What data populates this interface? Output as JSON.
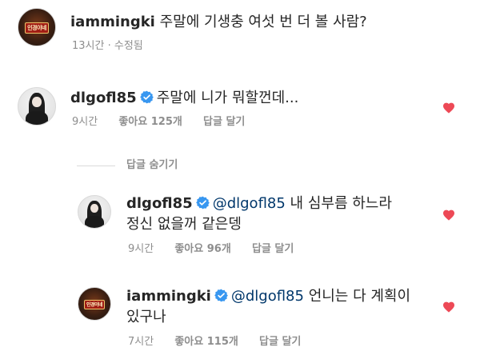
{
  "comments": [
    {
      "username": "iammingki",
      "verified": false,
      "text": "주말에 기생충 여섯 번 더 볼 사람?",
      "time": "13시간",
      "edited": "· 수정됨",
      "avatar_sign": "인경이네"
    },
    {
      "username": "dlgofl85",
      "verified": true,
      "text": "주말에 니가 뭐할껀데...",
      "time": "9시간",
      "likes": "좋아요 125개",
      "reply_label": "답글 달기"
    }
  ],
  "hide_replies_label": "답글 숨기기",
  "replies": [
    {
      "username": "dlgofl85",
      "verified": true,
      "mention": "@dlgofl85",
      "text_line1": "내 심부름 하느라",
      "text_line2": "정신 없을꺼 같은뎅",
      "time": "9시간",
      "likes": "좋아요 96개",
      "reply_label": "답글 달기"
    },
    {
      "username": "iammingki",
      "verified": true,
      "mention": "@dlgofl85",
      "text_line1": "언니는 다 계획이",
      "text_line2": "있구나",
      "time": "7시간",
      "likes": "좋아요 115개",
      "reply_label": "답글 달기",
      "avatar_sign": "인경이네"
    }
  ],
  "colors": {
    "heart": "#ed4956",
    "verified": "#3897f0",
    "mention": "#00376b",
    "meta": "#8e8e8e"
  }
}
